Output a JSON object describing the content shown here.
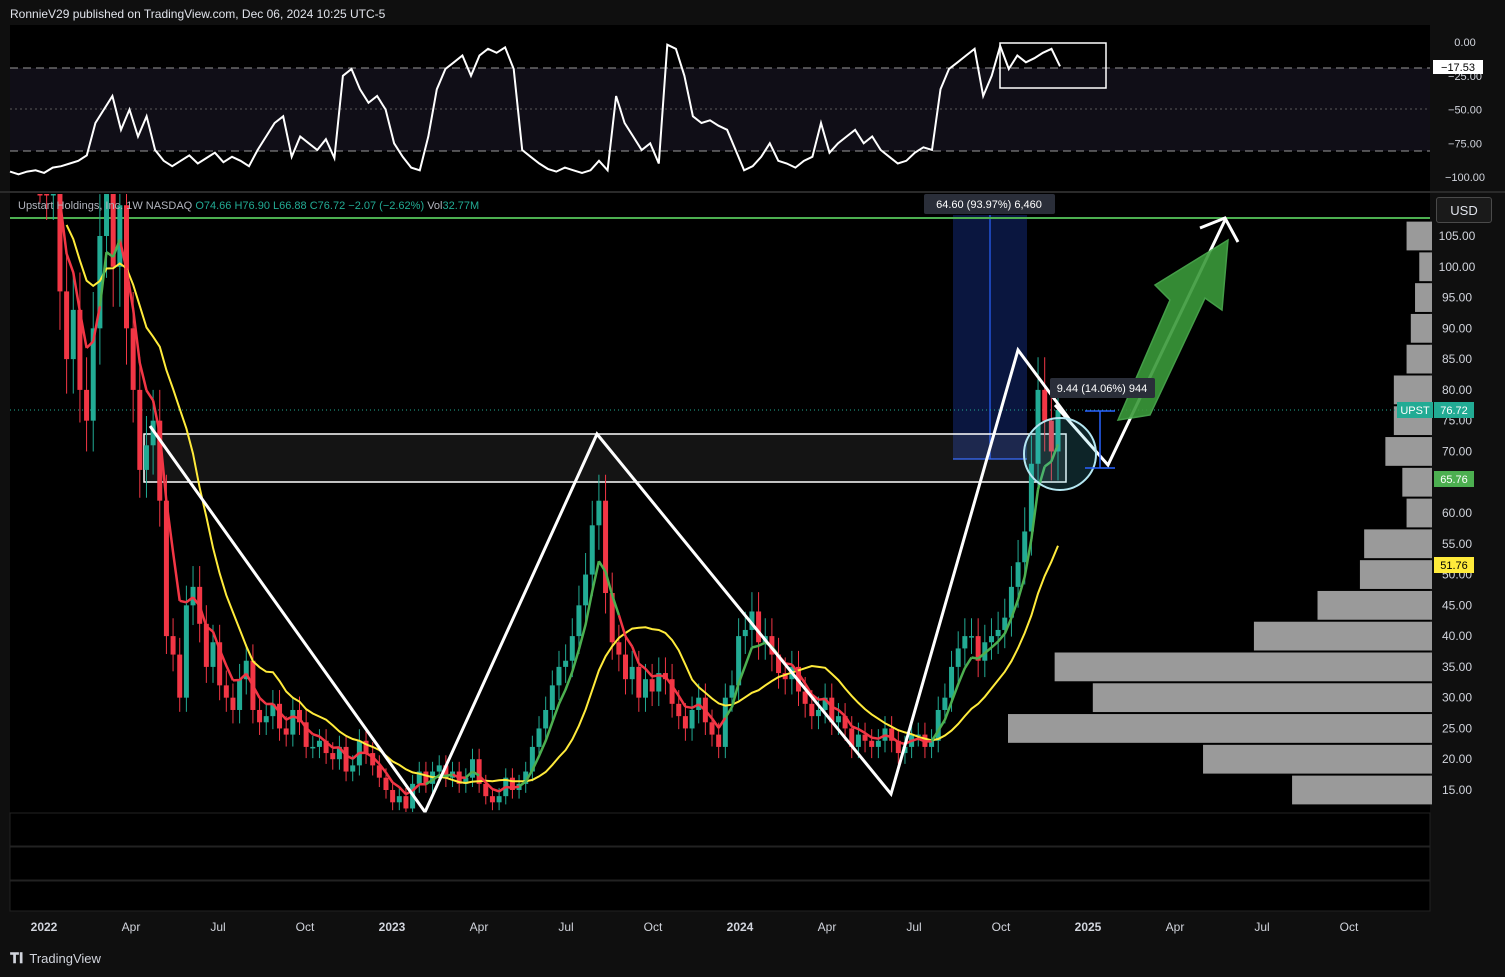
{
  "header": {
    "published": "RonnieV29 published on TradingView.com, Dec 06, 2024 10:25 UTC-5"
  },
  "footer": {
    "brand": "TradingView",
    "brand_icon": "tradingview-logo-icon"
  },
  "currency_button": "USD",
  "legend": {
    "symbol_name": "Upstart Holdings, Inc.",
    "interval": "1W",
    "exchange": "NASDAQ",
    "open": "O74.66",
    "high": "H76.90",
    "low": "L66.88",
    "close": "C76.72",
    "change": "−2.07 (−2.62%)",
    "volume_label": "Vol",
    "volume": "32.77M"
  },
  "colors": {
    "background": "#000000",
    "panel_background": "#0f0f0f",
    "up_candle": "#22ab94",
    "down_candle": "#f23645",
    "ema_fast": "#f23645",
    "ema_mid": "#4caf50",
    "sma_slow": "#ffeb3b",
    "resistance_line": "#4caf50",
    "volume_profile": "#9a9a9a",
    "measure_box": "#1a2a6e"
  },
  "chart_data": [
    {
      "type": "line",
      "title": "",
      "indicator": "oscillator",
      "ylim": [
        -100,
        0
      ],
      "y_ticks": [
        "0.00",
        "−25.00",
        "−50.00",
        "−75.00",
        "−100.00"
      ],
      "levels": [
        -20,
        -80
      ],
      "current_value": "−17.53",
      "series": [
        {
          "values": [
            -96,
            -98,
            -96,
            -95,
            -97,
            -93,
            -92,
            -90,
            -88,
            -84,
            -60,
            -50,
            -40,
            -65,
            -50,
            -70,
            -55,
            -80,
            -88,
            -92,
            -88,
            -84,
            -90,
            -86,
            -82,
            -89,
            -85,
            -88,
            -92,
            -80,
            -70,
            -60,
            -55,
            -85,
            -70,
            -75,
            -80,
            -72,
            -86,
            -25,
            -20,
            -35,
            -45,
            -40,
            -50,
            -75,
            -85,
            -93,
            -95,
            -70,
            -35,
            -20,
            -15,
            -10,
            -25,
            -10,
            -5,
            -8,
            -4,
            -20,
            -80,
            -85,
            -90,
            -94,
            -96,
            -93,
            -95,
            -97,
            -95,
            -88,
            -95,
            -40,
            -60,
            -70,
            -80,
            -75,
            -90,
            -2,
            -5,
            -25,
            -55,
            -60,
            -58,
            -62,
            -65,
            -80,
            -95,
            -92,
            -85,
            -75,
            -88,
            -90,
            -93,
            -88,
            -85,
            -60,
            -82,
            -75,
            -70,
            -65,
            -75,
            -70,
            -80,
            -85,
            -90,
            -88,
            -82,
            -78,
            -80,
            -35,
            -20,
            -15,
            -10,
            -5,
            -40,
            -25,
            -3,
            -20,
            -10,
            -15,
            -12,
            -8,
            -5,
            -18
          ]
        }
      ]
    },
    {
      "type": "candlestick",
      "title": "",
      "symbol": "UPST",
      "x_ticks": [
        "2022",
        "Apr",
        "Jul",
        "Oct",
        "2023",
        "Apr",
        "Jul",
        "Oct",
        "2024",
        "Apr",
        "Jul",
        "Oct",
        "2025",
        "Apr",
        "Jul",
        "Oct"
      ],
      "y_ticks": [
        "15.00",
        "20.00",
        "25.00",
        "30.00",
        "35.00",
        "40.00",
        "45.00",
        "50.00",
        "55.00",
        "60.00",
        "65.00",
        "70.00",
        "75.00",
        "80.00",
        "85.00",
        "90.00",
        "95.00",
        "100.00",
        "105.00"
      ],
      "ylim": [
        12,
        108
      ],
      "candles_close": [
        118,
        115,
        120,
        96,
        85,
        93,
        80,
        75,
        90,
        105,
        120,
        100,
        110,
        90,
        80,
        67,
        71,
        75,
        62,
        40,
        37,
        30,
        45,
        48,
        42,
        35,
        39,
        32,
        30,
        28,
        33,
        36,
        28,
        26,
        27,
        29,
        25,
        24,
        28,
        26,
        22,
        22,
        23,
        21,
        20,
        22,
        18,
        19,
        23,
        21,
        19,
        17,
        15,
        13,
        14,
        12,
        16,
        18,
        16,
        18,
        19,
        17,
        18,
        16,
        17,
        20,
        16,
        14,
        13,
        14,
        17,
        15,
        16,
        18,
        22,
        25,
        28,
        32,
        35,
        36,
        40,
        45,
        50,
        58,
        62,
        47,
        39,
        37,
        33,
        35,
        30,
        33,
        31,
        34,
        33,
        29,
        27,
        25,
        28,
        30,
        26,
        24,
        22,
        30,
        32,
        40,
        41,
        44,
        39,
        40,
        37,
        34,
        33,
        35,
        31,
        29,
        27,
        28,
        30,
        26,
        27,
        25,
        22,
        24,
        23,
        22,
        23,
        25,
        23,
        21,
        22,
        24,
        24,
        22,
        23,
        28,
        30,
        35,
        38,
        40,
        40,
        36,
        39,
        40,
        41,
        43,
        48,
        52,
        57,
        68,
        80,
        75,
        70,
        76.72
      ],
      "price_labels": [
        {
          "name": "UPST",
          "value": "76.72"
        },
        {
          "name": "ema-green",
          "value": "65.76"
        },
        {
          "name": "sma-yellow",
          "value": "51.76"
        }
      ],
      "resistance_level": 108,
      "zone": {
        "low": 65,
        "high": 73
      },
      "measure_label": "64.60 (93.97%) 6,460",
      "small_measure_label": "9.44 (14.06%) 944",
      "pattern_points": [
        {
          "date": "2022-03",
          "price": 73
        },
        {
          "date": "2023-01",
          "price": 12
        },
        {
          "date": "2023-08",
          "price": 73
        },
        {
          "date": "2024-06",
          "price": 14
        },
        {
          "date": "2024-10",
          "price": 87
        },
        {
          "date": "2024-12",
          "price": 66
        },
        {
          "date": "2025-06",
          "price": 108
        }
      ],
      "volume_profile": [
        {
          "price": 105,
          "size": 0.06
        },
        {
          "price": 100,
          "size": 0.03
        },
        {
          "price": 95,
          "size": 0.04
        },
        {
          "price": 90,
          "size": 0.05
        },
        {
          "price": 85,
          "size": 0.06
        },
        {
          "price": 80,
          "size": 0.09
        },
        {
          "price": 75,
          "size": 0.09
        },
        {
          "price": 70,
          "size": 0.11
        },
        {
          "price": 65,
          "size": 0.07
        },
        {
          "price": 60,
          "size": 0.06
        },
        {
          "price": 55,
          "size": 0.16
        },
        {
          "price": 50,
          "size": 0.17
        },
        {
          "price": 45,
          "size": 0.27
        },
        {
          "price": 40,
          "size": 0.42
        },
        {
          "price": 35,
          "size": 0.89
        },
        {
          "price": 30,
          "size": 0.8
        },
        {
          "price": 25,
          "size": 1.0
        },
        {
          "price": 20,
          "size": 0.54
        },
        {
          "price": 15,
          "size": 0.33
        }
      ]
    }
  ]
}
